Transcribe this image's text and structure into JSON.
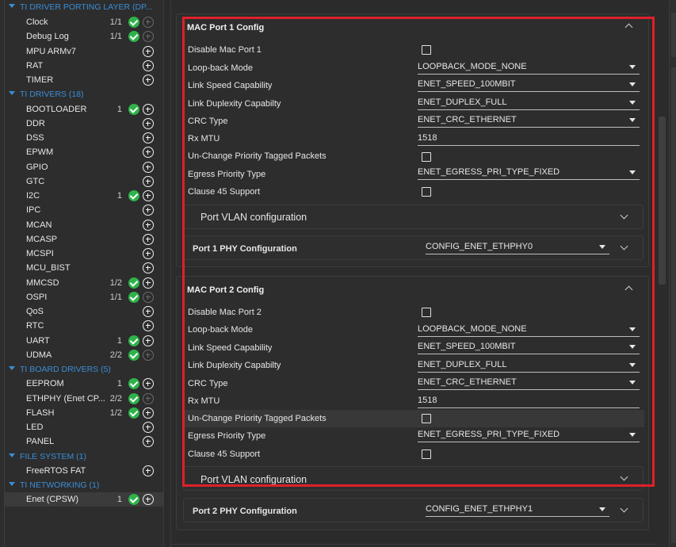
{
  "tree": {
    "items": [
      {
        "kind": "category",
        "label": "TI DRIVER PORTING LAYER (DP..."
      },
      {
        "kind": "item",
        "label": "Clock",
        "count": "1/1",
        "check": true,
        "plus": "dim"
      },
      {
        "kind": "item",
        "label": "Debug Log",
        "count": "1/1",
        "check": true,
        "plus": "dim"
      },
      {
        "kind": "item",
        "label": "MPU ARMv7",
        "count": "",
        "check": false,
        "plus": "on"
      },
      {
        "kind": "item",
        "label": "RAT",
        "count": "",
        "check": false,
        "plus": "on"
      },
      {
        "kind": "item",
        "label": "TIMER",
        "count": "",
        "check": false,
        "plus": "on"
      },
      {
        "kind": "category",
        "label": "TI DRIVERS (18)"
      },
      {
        "kind": "item",
        "label": "BOOTLOADER",
        "count": "1",
        "check": true,
        "plus": "on"
      },
      {
        "kind": "item",
        "label": "DDR",
        "count": "",
        "check": false,
        "plus": "on"
      },
      {
        "kind": "item",
        "label": "DSS",
        "count": "",
        "check": false,
        "plus": "on"
      },
      {
        "kind": "item",
        "label": "EPWM",
        "count": "",
        "check": false,
        "plus": "on"
      },
      {
        "kind": "item",
        "label": "GPIO",
        "count": "",
        "check": false,
        "plus": "on"
      },
      {
        "kind": "item",
        "label": "GTC",
        "count": "",
        "check": false,
        "plus": "on"
      },
      {
        "kind": "item",
        "label": "I2C",
        "count": "1",
        "check": true,
        "plus": "on"
      },
      {
        "kind": "item",
        "label": "IPC",
        "count": "",
        "check": false,
        "plus": "on"
      },
      {
        "kind": "item",
        "label": "MCAN",
        "count": "",
        "check": false,
        "plus": "on"
      },
      {
        "kind": "item",
        "label": "MCASP",
        "count": "",
        "check": false,
        "plus": "on"
      },
      {
        "kind": "item",
        "label": "MCSPI",
        "count": "",
        "check": false,
        "plus": "on"
      },
      {
        "kind": "item",
        "label": "MCU_BIST",
        "count": "",
        "check": false,
        "plus": "on"
      },
      {
        "kind": "item",
        "label": "MMCSD",
        "count": "1/2",
        "check": true,
        "plus": "on"
      },
      {
        "kind": "item",
        "label": "OSPI",
        "count": "1/1",
        "check": true,
        "plus": "dim"
      },
      {
        "kind": "item",
        "label": "QoS",
        "count": "",
        "check": false,
        "plus": "on"
      },
      {
        "kind": "item",
        "label": "RTC",
        "count": "",
        "check": false,
        "plus": "on"
      },
      {
        "kind": "item",
        "label": "UART",
        "count": "1",
        "check": true,
        "plus": "on"
      },
      {
        "kind": "item",
        "label": "UDMA",
        "count": "2/2",
        "check": true,
        "plus": "dim"
      },
      {
        "kind": "category",
        "label": "TI BOARD DRIVERS (5)"
      },
      {
        "kind": "item",
        "label": "EEPROM",
        "count": "1",
        "check": true,
        "plus": "on"
      },
      {
        "kind": "item",
        "label": "ETHPHY (Enet CP...",
        "count": "2/2",
        "check": true,
        "plus": "dim"
      },
      {
        "kind": "item",
        "label": "FLASH",
        "count": "1/2",
        "check": true,
        "plus": "on"
      },
      {
        "kind": "item",
        "label": "LED",
        "count": "",
        "check": false,
        "plus": "on"
      },
      {
        "kind": "item",
        "label": "PANEL",
        "count": "",
        "check": false,
        "plus": "on"
      },
      {
        "kind": "category",
        "label": "FILE SYSTEM (1)"
      },
      {
        "kind": "item",
        "label": "FreeRTOS FAT",
        "count": "",
        "check": false,
        "plus": "on"
      },
      {
        "kind": "category",
        "label": "TI NETWORKING (1)"
      },
      {
        "kind": "item",
        "label": "Enet (CPSW)",
        "count": "1",
        "check": true,
        "plus": "on",
        "selected": true
      }
    ]
  },
  "port1": {
    "title": "MAC Port 1 Config",
    "fields": {
      "disable_label": "Disable Mac Port 1",
      "loopback_label": "Loop-back Mode",
      "loopback_value": "LOOPBACK_MODE_NONE",
      "speed_label": "Link Speed Capability",
      "speed_value": "ENET_SPEED_100MBIT",
      "duplex_label": "Link Duplexity Capabilty",
      "duplex_value": "ENET_DUPLEX_FULL",
      "crc_label": "CRC Type",
      "crc_value": "ENET_CRC_ETHERNET",
      "mtu_label": "Rx MTU",
      "mtu_value": "1518",
      "unchange_label": "Un-Change Priority Tagged Packets",
      "egress_label": "Egress Priority Type",
      "egress_value": "ENET_EGRESS_PRI_TYPE_FIXED",
      "clause45_label": "Clause 45 Support"
    },
    "vlan_label": "Port VLAN configuration",
    "phy_label": "Port 1 PHY Configuration",
    "phy_value": "CONFIG_ENET_ETHPHY0"
  },
  "port2": {
    "title": "MAC Port 2 Config",
    "fields": {
      "disable_label": "Disable Mac Port 2",
      "loopback_label": "Loop-back Mode",
      "loopback_value": "LOOPBACK_MODE_NONE",
      "speed_label": "Link Speed Capability",
      "speed_value": "ENET_SPEED_100MBIT",
      "duplex_label": "Link Duplexity Capabilty",
      "duplex_value": "ENET_DUPLEX_FULL",
      "crc_label": "CRC Type",
      "crc_value": "ENET_CRC_ETHERNET",
      "mtu_label": "Rx MTU",
      "mtu_value": "1518",
      "unchange_label": "Un-Change Priority Tagged Packets",
      "egress_label": "Egress Priority Type",
      "egress_value": "ENET_EGRESS_PRI_TYPE_FIXED",
      "clause45_label": "Clause 45 Support"
    },
    "vlan_label": "Port VLAN configuration",
    "phy_label": "Port 2 PHY Configuration",
    "phy_value": "CONFIG_ENET_ETHPHY1"
  },
  "colors": {
    "category": "#3a8dd6",
    "check": "#2fb24a",
    "highlight_box": "#e0202a"
  }
}
